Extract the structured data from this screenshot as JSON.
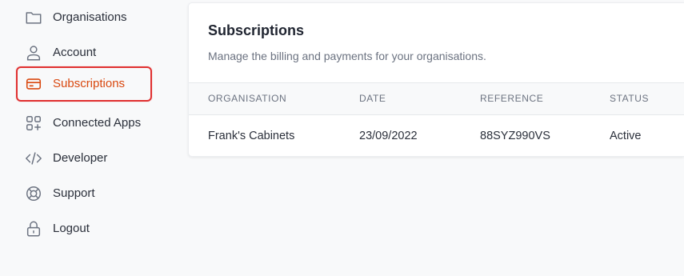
{
  "sidebar": {
    "items": [
      {
        "label": "Organisations",
        "icon": "folder-icon",
        "active": false
      },
      {
        "label": "Account",
        "icon": "user-icon",
        "active": false
      },
      {
        "label": "Subscriptions",
        "icon": "credit-card-icon",
        "active": true
      },
      {
        "label": "Connected Apps",
        "icon": "apps-grid-plus-icon",
        "active": false
      },
      {
        "label": "Developer",
        "icon": "code-icon",
        "active": false
      },
      {
        "label": "Support",
        "icon": "lifebuoy-icon",
        "active": false
      },
      {
        "label": "Logout",
        "icon": "lock-icon",
        "active": false
      }
    ]
  },
  "subscriptions": {
    "title": "Subscriptions",
    "description": "Manage the billing and payments for your organisations.",
    "columns": [
      "ORGANISATION",
      "DATE",
      "REFERENCE",
      "STATUS"
    ],
    "rows": [
      {
        "organisation": "Frank's Cabinets",
        "date": "23/09/2022",
        "reference": "88SYZ990VS",
        "status": "Active"
      }
    ]
  },
  "colors": {
    "accent": "#d9480f",
    "highlight_border": "#e03131",
    "icon": "#6b7280"
  }
}
